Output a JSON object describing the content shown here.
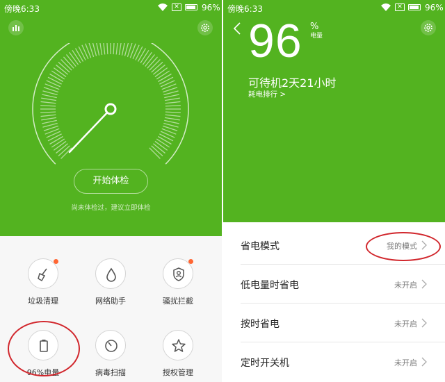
{
  "colors": {
    "accent": "#53b320",
    "dot": "#ff6633",
    "annotation": "#d1262c"
  },
  "left": {
    "status": {
      "time": "傍晚6:33",
      "battery": "96%"
    },
    "gauge": {
      "fill_fraction": 1.0
    },
    "start_button": "开始体检",
    "hint": "尚未体检过，建议立即体检",
    "tools": [
      {
        "label": "垃圾清理",
        "icon": "broom-icon",
        "badge": true
      },
      {
        "label": "网络助手",
        "icon": "drop-icon",
        "badge": false
      },
      {
        "label": "骚扰拦截",
        "icon": "shield-person-icon",
        "badge": true
      },
      {
        "label": "96%电量",
        "icon": "battery-icon",
        "badge": false
      },
      {
        "label": "病毒扫描",
        "icon": "scan-icon",
        "badge": false
      },
      {
        "label": "授权管理",
        "icon": "star-icon",
        "badge": false
      }
    ]
  },
  "right": {
    "status": {
      "time": "傍晚6:33",
      "battery": "96%"
    },
    "battery_value": "96",
    "percent_sign": "%",
    "unit": "电量",
    "standby": "可待机2天21小时",
    "rank_link": "耗电排行 >",
    "rows": [
      {
        "name": "省电模式",
        "value": "我的模式"
      },
      {
        "name": "低电量时省电",
        "value": "未开启"
      },
      {
        "name": "按时省电",
        "value": "未开启"
      },
      {
        "name": "定时开关机",
        "value": "未开启"
      }
    ]
  }
}
